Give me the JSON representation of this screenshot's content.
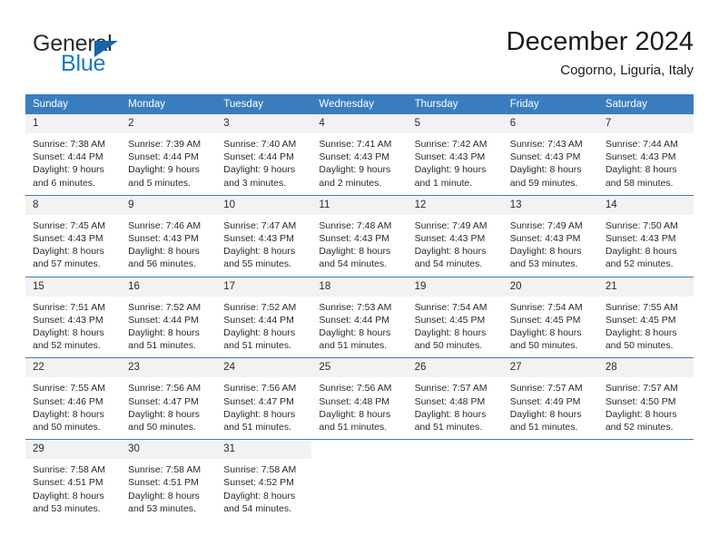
{
  "brand": {
    "name_part1": "General",
    "name_part2": "Blue",
    "triangle_icon": "triangle-icon",
    "accent_color": "#1d79c4",
    "header_color": "#3a7dbf"
  },
  "header": {
    "title": "December 2024",
    "subtitle": "Cogorno, Liguria, Italy"
  },
  "weekday_headers": [
    "Sunday",
    "Monday",
    "Tuesday",
    "Wednesday",
    "Thursday",
    "Friday",
    "Saturday"
  ],
  "labels": {
    "sunrise_prefix": "Sunrise:",
    "sunset_prefix": "Sunset:",
    "daylight_prefix": "Daylight:"
  },
  "weeks": [
    [
      {
        "day": "1",
        "sunrise": "Sunrise: 7:38 AM",
        "sunset": "Sunset: 4:44 PM",
        "daylight_line1": "Daylight: 9 hours",
        "daylight_line2": "and 6 minutes."
      },
      {
        "day": "2",
        "sunrise": "Sunrise: 7:39 AM",
        "sunset": "Sunset: 4:44 PM",
        "daylight_line1": "Daylight: 9 hours",
        "daylight_line2": "and 5 minutes."
      },
      {
        "day": "3",
        "sunrise": "Sunrise: 7:40 AM",
        "sunset": "Sunset: 4:44 PM",
        "daylight_line1": "Daylight: 9 hours",
        "daylight_line2": "and 3 minutes."
      },
      {
        "day": "4",
        "sunrise": "Sunrise: 7:41 AM",
        "sunset": "Sunset: 4:43 PM",
        "daylight_line1": "Daylight: 9 hours",
        "daylight_line2": "and 2 minutes."
      },
      {
        "day": "5",
        "sunrise": "Sunrise: 7:42 AM",
        "sunset": "Sunset: 4:43 PM",
        "daylight_line1": "Daylight: 9 hours",
        "daylight_line2": "and 1 minute."
      },
      {
        "day": "6",
        "sunrise": "Sunrise: 7:43 AM",
        "sunset": "Sunset: 4:43 PM",
        "daylight_line1": "Daylight: 8 hours",
        "daylight_line2": "and 59 minutes."
      },
      {
        "day": "7",
        "sunrise": "Sunrise: 7:44 AM",
        "sunset": "Sunset: 4:43 PM",
        "daylight_line1": "Daylight: 8 hours",
        "daylight_line2": "and 58 minutes."
      }
    ],
    [
      {
        "day": "8",
        "sunrise": "Sunrise: 7:45 AM",
        "sunset": "Sunset: 4:43 PM",
        "daylight_line1": "Daylight: 8 hours",
        "daylight_line2": "and 57 minutes."
      },
      {
        "day": "9",
        "sunrise": "Sunrise: 7:46 AM",
        "sunset": "Sunset: 4:43 PM",
        "daylight_line1": "Daylight: 8 hours",
        "daylight_line2": "and 56 minutes."
      },
      {
        "day": "10",
        "sunrise": "Sunrise: 7:47 AM",
        "sunset": "Sunset: 4:43 PM",
        "daylight_line1": "Daylight: 8 hours",
        "daylight_line2": "and 55 minutes."
      },
      {
        "day": "11",
        "sunrise": "Sunrise: 7:48 AM",
        "sunset": "Sunset: 4:43 PM",
        "daylight_line1": "Daylight: 8 hours",
        "daylight_line2": "and 54 minutes."
      },
      {
        "day": "12",
        "sunrise": "Sunrise: 7:49 AM",
        "sunset": "Sunset: 4:43 PM",
        "daylight_line1": "Daylight: 8 hours",
        "daylight_line2": "and 54 minutes."
      },
      {
        "day": "13",
        "sunrise": "Sunrise: 7:49 AM",
        "sunset": "Sunset: 4:43 PM",
        "daylight_line1": "Daylight: 8 hours",
        "daylight_line2": "and 53 minutes."
      },
      {
        "day": "14",
        "sunrise": "Sunrise: 7:50 AM",
        "sunset": "Sunset: 4:43 PM",
        "daylight_line1": "Daylight: 8 hours",
        "daylight_line2": "and 52 minutes."
      }
    ],
    [
      {
        "day": "15",
        "sunrise": "Sunrise: 7:51 AM",
        "sunset": "Sunset: 4:43 PM",
        "daylight_line1": "Daylight: 8 hours",
        "daylight_line2": "and 52 minutes."
      },
      {
        "day": "16",
        "sunrise": "Sunrise: 7:52 AM",
        "sunset": "Sunset: 4:44 PM",
        "daylight_line1": "Daylight: 8 hours",
        "daylight_line2": "and 51 minutes."
      },
      {
        "day": "17",
        "sunrise": "Sunrise: 7:52 AM",
        "sunset": "Sunset: 4:44 PM",
        "daylight_line1": "Daylight: 8 hours",
        "daylight_line2": "and 51 minutes."
      },
      {
        "day": "18",
        "sunrise": "Sunrise: 7:53 AM",
        "sunset": "Sunset: 4:44 PM",
        "daylight_line1": "Daylight: 8 hours",
        "daylight_line2": "and 51 minutes."
      },
      {
        "day": "19",
        "sunrise": "Sunrise: 7:54 AM",
        "sunset": "Sunset: 4:45 PM",
        "daylight_line1": "Daylight: 8 hours",
        "daylight_line2": "and 50 minutes."
      },
      {
        "day": "20",
        "sunrise": "Sunrise: 7:54 AM",
        "sunset": "Sunset: 4:45 PM",
        "daylight_line1": "Daylight: 8 hours",
        "daylight_line2": "and 50 minutes."
      },
      {
        "day": "21",
        "sunrise": "Sunrise: 7:55 AM",
        "sunset": "Sunset: 4:45 PM",
        "daylight_line1": "Daylight: 8 hours",
        "daylight_line2": "and 50 minutes."
      }
    ],
    [
      {
        "day": "22",
        "sunrise": "Sunrise: 7:55 AM",
        "sunset": "Sunset: 4:46 PM",
        "daylight_line1": "Daylight: 8 hours",
        "daylight_line2": "and 50 minutes."
      },
      {
        "day": "23",
        "sunrise": "Sunrise: 7:56 AM",
        "sunset": "Sunset: 4:47 PM",
        "daylight_line1": "Daylight: 8 hours",
        "daylight_line2": "and 50 minutes."
      },
      {
        "day": "24",
        "sunrise": "Sunrise: 7:56 AM",
        "sunset": "Sunset: 4:47 PM",
        "daylight_line1": "Daylight: 8 hours",
        "daylight_line2": "and 51 minutes."
      },
      {
        "day": "25",
        "sunrise": "Sunrise: 7:56 AM",
        "sunset": "Sunset: 4:48 PM",
        "daylight_line1": "Daylight: 8 hours",
        "daylight_line2": "and 51 minutes."
      },
      {
        "day": "26",
        "sunrise": "Sunrise: 7:57 AM",
        "sunset": "Sunset: 4:48 PM",
        "daylight_line1": "Daylight: 8 hours",
        "daylight_line2": "and 51 minutes."
      },
      {
        "day": "27",
        "sunrise": "Sunrise: 7:57 AM",
        "sunset": "Sunset: 4:49 PM",
        "daylight_line1": "Daylight: 8 hours",
        "daylight_line2": "and 51 minutes."
      },
      {
        "day": "28",
        "sunrise": "Sunrise: 7:57 AM",
        "sunset": "Sunset: 4:50 PM",
        "daylight_line1": "Daylight: 8 hours",
        "daylight_line2": "and 52 minutes."
      }
    ],
    [
      {
        "day": "29",
        "sunrise": "Sunrise: 7:58 AM",
        "sunset": "Sunset: 4:51 PM",
        "daylight_line1": "Daylight: 8 hours",
        "daylight_line2": "and 53 minutes."
      },
      {
        "day": "30",
        "sunrise": "Sunrise: 7:58 AM",
        "sunset": "Sunset: 4:51 PM",
        "daylight_line1": "Daylight: 8 hours",
        "daylight_line2": "and 53 minutes."
      },
      {
        "day": "31",
        "sunrise": "Sunrise: 7:58 AM",
        "sunset": "Sunset: 4:52 PM",
        "daylight_line1": "Daylight: 8 hours",
        "daylight_line2": "and 54 minutes."
      },
      {
        "day": "",
        "sunrise": "",
        "sunset": "",
        "daylight_line1": "",
        "daylight_line2": ""
      },
      {
        "day": "",
        "sunrise": "",
        "sunset": "",
        "daylight_line1": "",
        "daylight_line2": ""
      },
      {
        "day": "",
        "sunrise": "",
        "sunset": "",
        "daylight_line1": "",
        "daylight_line2": ""
      },
      {
        "day": "",
        "sunrise": "",
        "sunset": "",
        "daylight_line1": "",
        "daylight_line2": ""
      }
    ]
  ]
}
